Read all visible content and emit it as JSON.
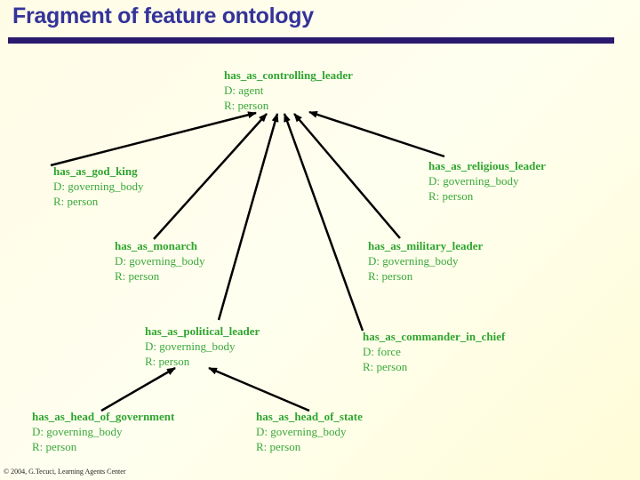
{
  "title": "Fragment of feature ontology",
  "colors": {
    "title": "#33339a",
    "rule": "#2a1a6e",
    "node_text": "#3aa83a",
    "arrow": "#000000"
  },
  "nodes": {
    "controlling_leader": {
      "name": "has_as_controlling_leader",
      "domain": "D: agent",
      "range": "R: person"
    },
    "god_king": {
      "name": "has_as_god_king",
      "domain": "D: governing_body",
      "range": "R: person"
    },
    "religious_leader": {
      "name": "has_as_religious_leader",
      "domain": "D: governing_body",
      "range": "R: person"
    },
    "monarch": {
      "name": "has_as_monarch",
      "domain": "D: governing_body",
      "range": "R: person"
    },
    "military_leader": {
      "name": "has_as_military_leader",
      "domain": "D: governing_body",
      "range": "R: person"
    },
    "political_leader": {
      "name": "has_as_political_leader",
      "domain": "D: governing_body",
      "range": "R: person"
    },
    "commander_in_chief": {
      "name": "has_as_commander_in_chief",
      "domain": "D: force",
      "range": "R: person"
    },
    "head_of_government": {
      "name": "has_as_head_of_government",
      "domain": "D: governing_body",
      "range": "R: person"
    },
    "head_of_state": {
      "name": "has_as_head_of_state",
      "domain": "D: governing_body",
      "range": "R: person"
    }
  },
  "edges": [
    {
      "from": "god_king",
      "to": "controlling_leader"
    },
    {
      "from": "monarch",
      "to": "controlling_leader"
    },
    {
      "from": "political_leader",
      "to": "controlling_leader"
    },
    {
      "from": "commander_in_chief",
      "to": "controlling_leader"
    },
    {
      "from": "military_leader",
      "to": "controlling_leader"
    },
    {
      "from": "religious_leader",
      "to": "controlling_leader"
    },
    {
      "from": "head_of_government",
      "to": "political_leader"
    },
    {
      "from": "head_of_state",
      "to": "political_leader"
    }
  ],
  "footer": "© 2004, G.Tecuci, Learning Agents Center"
}
